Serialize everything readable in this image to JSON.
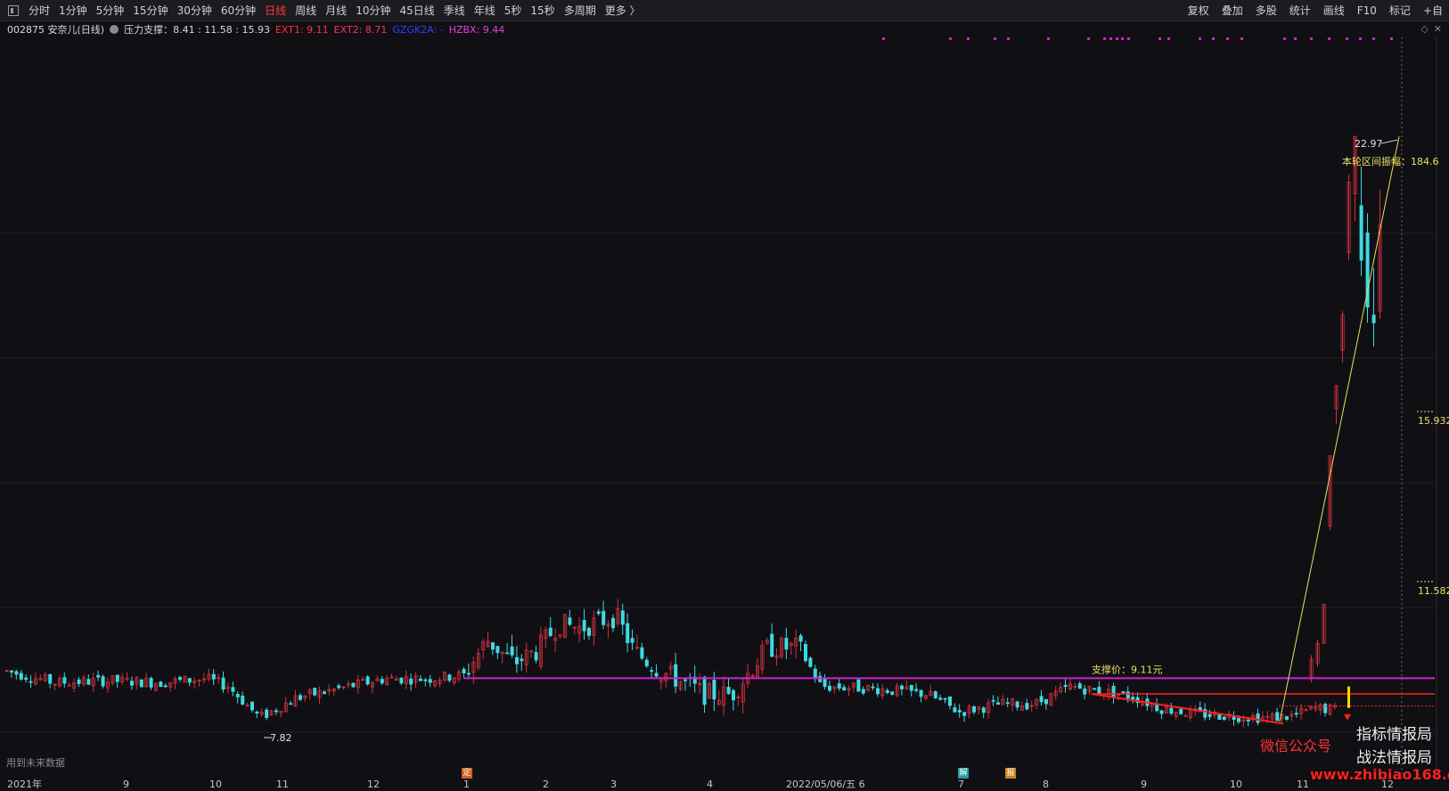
{
  "toolbar": {
    "periods": [
      "分时",
      "1分钟",
      "5分钟",
      "15分钟",
      "30分钟",
      "60分钟",
      "日线",
      "周线",
      "月线",
      "10分钟",
      "45日线",
      "季线",
      "年线",
      "5秒",
      "15秒",
      "多周期",
      "更多 〉"
    ],
    "active_period": "日线",
    "right_buttons": [
      "复权",
      "叠加",
      "多股",
      "统计",
      "画线",
      "F10",
      "标记",
      "+自"
    ]
  },
  "info": {
    "stock": "002875 安奈儿(日线)",
    "indicator": "压力支撑：8.41 : 11.58 : 15.93",
    "ext1": "EXT1: 9.11",
    "ext2": "EXT2: 8.71",
    "gzgk": "GZGK2A: -",
    "hzbx": "HZBX: 9.44"
  },
  "colors": {
    "up": "#d0303c",
    "down": "#40d8e0",
    "support": "#d020d0",
    "resistance": "#ff2020",
    "trend": "#e8e060"
  },
  "chart_data": {
    "type": "candlestick",
    "ylim": [
      6.5,
      25.5
    ],
    "support_label": "支撑价：9.11元",
    "support_price": 9.11,
    "levels": [
      {
        "value": 15.932,
        "label": "15.932"
      },
      {
        "value": 11.582,
        "label": "11.582"
      }
    ],
    "annotations": {
      "high_label": "22.97",
      "high_value": 22.97,
      "low_label": "7.82",
      "low_value": 7.82,
      "range_label": "本轮区间振幅：184.6"
    },
    "x_ticks": [
      "2021年",
      "9",
      "10",
      "11",
      "12",
      "1",
      "2",
      "3",
      "4",
      "5",
      "2022/05/06/五 6",
      "7",
      "8",
      "9",
      "10",
      "11",
      "12"
    ]
  },
  "events": {
    "ding": "定",
    "jie": "解",
    "bao": "报"
  },
  "footer": {
    "future_note": "用到未来数据",
    "watermark_1": "指标情报局",
    "watermark_2": "战法情报局",
    "watermark_3": "微信公众号",
    "watermark_4": "www.zhibiao168.com"
  }
}
